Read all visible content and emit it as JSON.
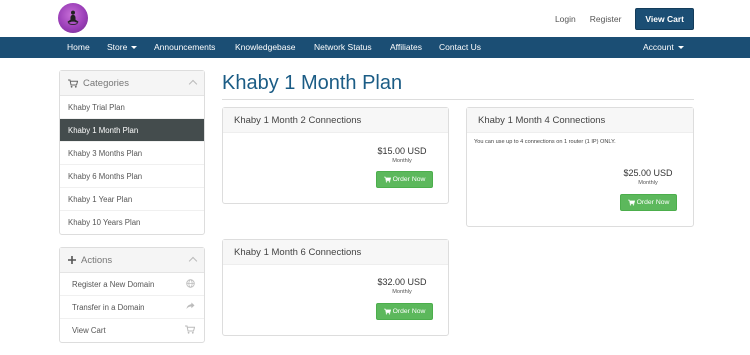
{
  "header": {
    "login_label": "Login",
    "register_label": "Register",
    "view_cart_label": "View Cart"
  },
  "nav": {
    "items": [
      {
        "label": "Home",
        "has_dropdown": false
      },
      {
        "label": "Store",
        "has_dropdown": true
      },
      {
        "label": "Announcements",
        "has_dropdown": false
      },
      {
        "label": "Knowledgebase",
        "has_dropdown": false
      },
      {
        "label": "Network Status",
        "has_dropdown": false
      },
      {
        "label": "Affiliates",
        "has_dropdown": false
      },
      {
        "label": "Contact Us",
        "has_dropdown": false
      }
    ],
    "account_label": "Account"
  },
  "sidebar": {
    "categories": {
      "title": "Categories",
      "items": [
        {
          "label": "Khaby Trial Plan",
          "active": false
        },
        {
          "label": "Khaby 1 Month Plan",
          "active": true
        },
        {
          "label": "Khaby 3 Months Plan",
          "active": false
        },
        {
          "label": "Khaby 6 Months Plan",
          "active": false
        },
        {
          "label": "Khaby 1 Year Plan",
          "active": false
        },
        {
          "label": "Khaby 10 Years Plan",
          "active": false
        }
      ]
    },
    "actions": {
      "title": "Actions",
      "items": [
        {
          "label": "Register a New Domain",
          "icon": "globe-icon"
        },
        {
          "label": "Transfer in a Domain",
          "icon": "share-icon"
        },
        {
          "label": "View Cart",
          "icon": "cart-icon"
        }
      ]
    }
  },
  "main": {
    "title": "Khaby 1 Month Plan",
    "products": [
      {
        "name": "Khaby 1 Month 2 Connections",
        "description": "",
        "price": "$15.00 USD",
        "cycle": "Monthly",
        "button": "Order Now"
      },
      {
        "name": "Khaby 1 Month 4 Connections",
        "description": "You can use up to 4 connections on 1 router (1 IP) ONLY.",
        "price": "$25.00 USD",
        "cycle": "Monthly",
        "button": "Order Now"
      },
      {
        "name": "Khaby 1 Month 6 Connections",
        "description": "",
        "price": "$32.00 USD",
        "cycle": "Monthly",
        "button": "Order Now"
      }
    ]
  },
  "colors": {
    "brand_navy": "#1b4e74",
    "title_blue": "#1b5c85",
    "order_green": "#5cb85c",
    "active_item": "#444c4d"
  }
}
